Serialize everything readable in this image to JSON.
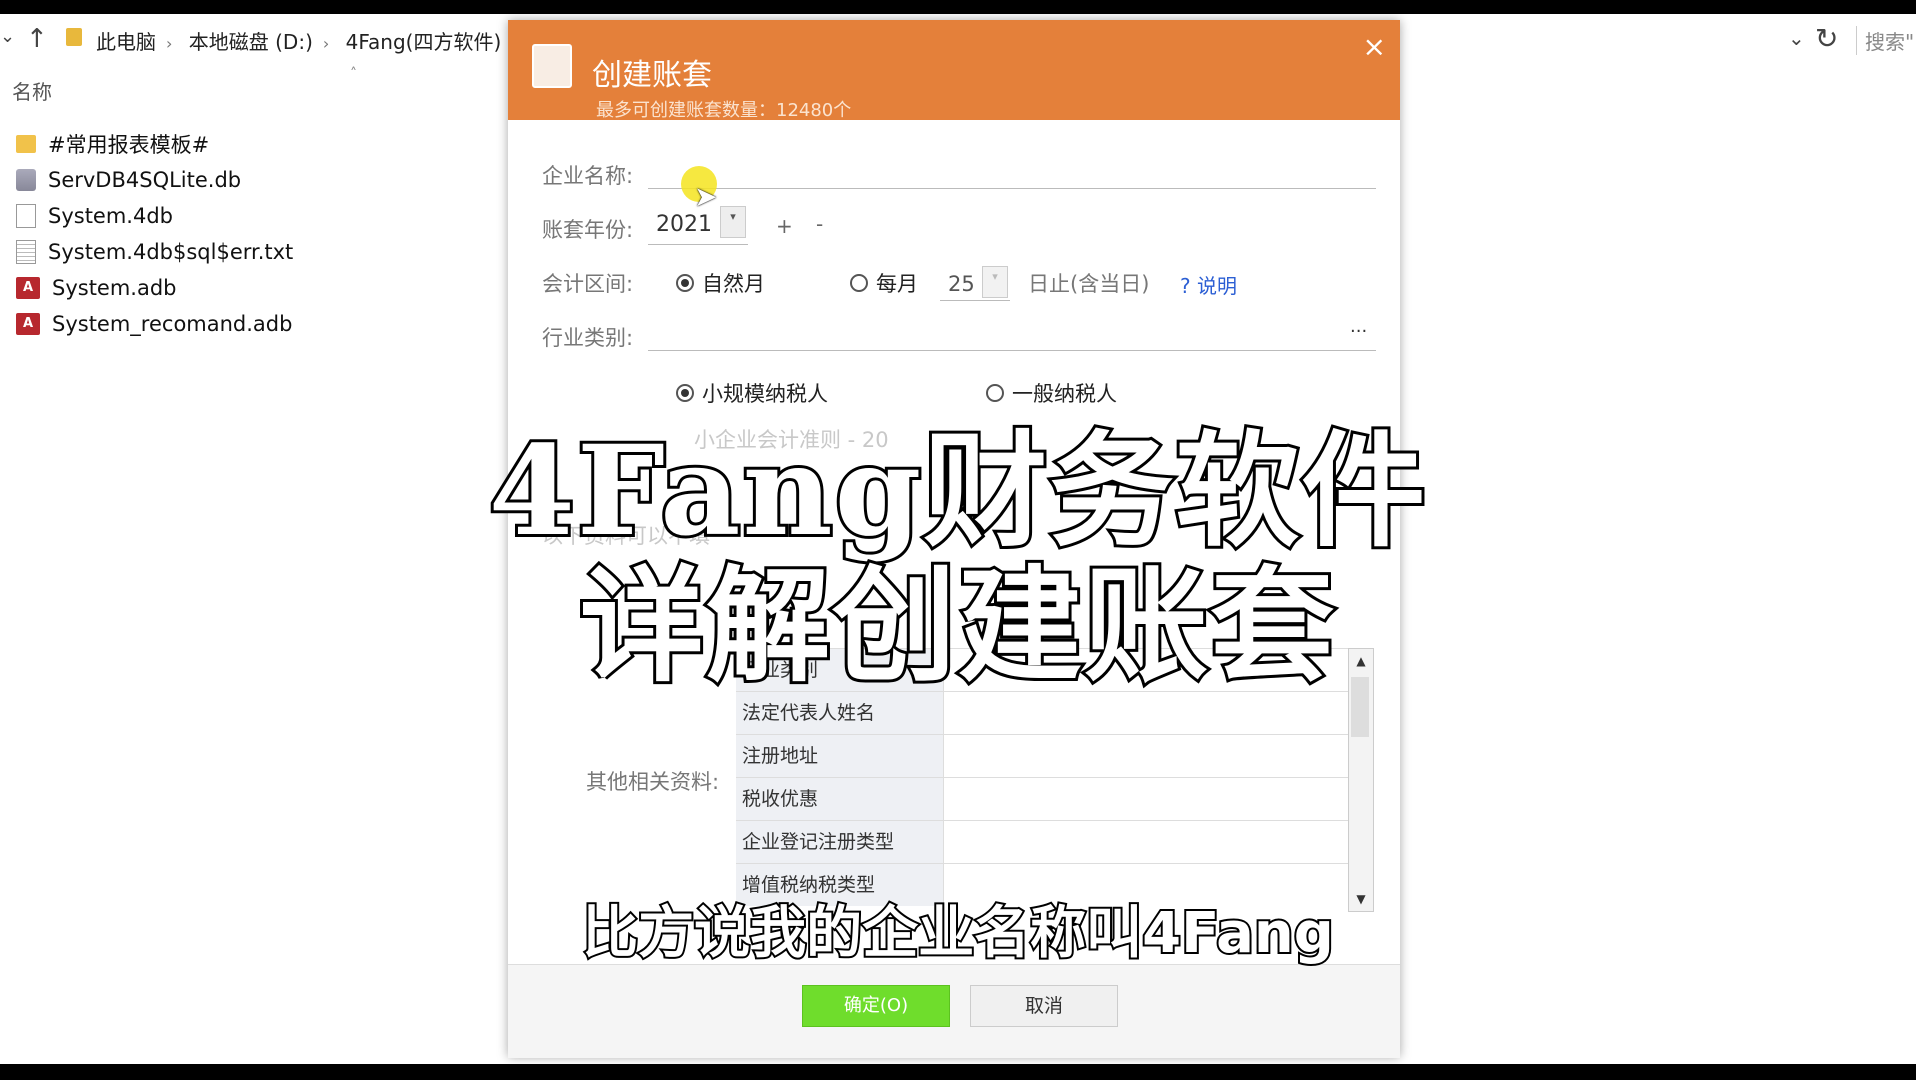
{
  "explorer": {
    "breadcrumbs": [
      "此电脑",
      "本地磁盘 (D:)",
      "4Fang(四方软件)"
    ],
    "search_label": "搜索\"",
    "column_name": "名称",
    "files": [
      {
        "name": "#常用报表模板#",
        "icon": "folder-icon"
      },
      {
        "name": "ServDB4SQLite.db",
        "icon": "database-file-icon"
      },
      {
        "name": "System.4db",
        "icon": "file-icon"
      },
      {
        "name": "System.4db$sql$err.txt",
        "icon": "text-file-icon"
      },
      {
        "name": "System.adb",
        "icon": "access-file-icon"
      },
      {
        "name": "System_recomand.adb",
        "icon": "access-file-icon"
      }
    ]
  },
  "dialog": {
    "title": "创建账套",
    "subtitle": "最多可创建账套数量：12480个",
    "close": "×",
    "company_label": "企业名称:",
    "company_value": "",
    "year_label": "账套年份:",
    "year_value": "2021",
    "plus": "+",
    "minus": "-",
    "period_label": "会计区间:",
    "period_natural": "自然月",
    "period_monthly": "每月",
    "period_day": "25",
    "period_suffix": "日止(含当日)",
    "help_link": "? 说明",
    "industry_label": "行业类别:",
    "industry_button": "...",
    "taxpayer_small": "小规模纳税人",
    "taxpayer_general": "一般纳税人",
    "standard_text": "小企业会计准则 - 20",
    "optional_text": "以下资料可以不填",
    "other_label": "其他相关资料:",
    "grid_rows": [
      "行业类别",
      "法定代表人姓名",
      "注册地址",
      "税收优惠",
      "企业登记注册类型",
      "增值税纳税类型"
    ],
    "ok_button": "确定(O)",
    "cancel_button": "取消"
  },
  "overlay": {
    "title_line1": "4Fang财务软件",
    "title_line2": "详解创建账套",
    "subtitle": "比方说我的企业名称叫4Fang"
  },
  "colors": {
    "dialog_header": "#e4803a",
    "ok_button": "#6fdd2c",
    "help_link": "#2c5fd4",
    "cursor_highlight": "#f4e41e"
  }
}
